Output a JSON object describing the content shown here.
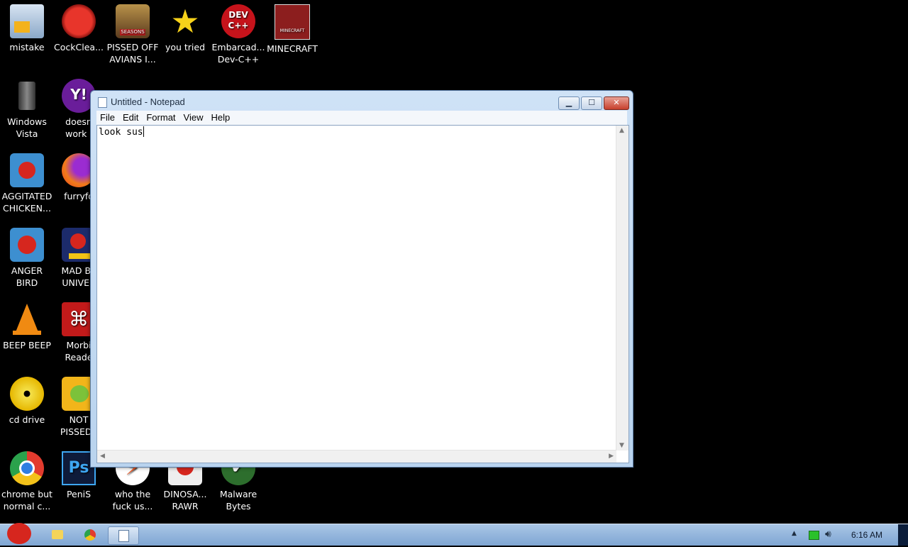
{
  "desktop": {
    "icons": [
      {
        "label": "mistake"
      },
      {
        "label": "CockClea..."
      },
      {
        "label": "PISSED OFF\nAVIANS I..."
      },
      {
        "label": "you tried"
      },
      {
        "label": "Embarcad...\nDev-C++"
      },
      {
        "label": "MINECRAFT"
      },
      {
        "label": "Windows\nVista"
      },
      {
        "label": "doesn\nwork l"
      },
      {
        "label": "AGGITATED\nCHICKEN..."
      },
      {
        "label": "furryfo"
      },
      {
        "label": "ANGER\nBIRD"
      },
      {
        "label": "MAD BII\nUNIVER"
      },
      {
        "label": "BEEP BEEP"
      },
      {
        "label": "Morbi\nReade"
      },
      {
        "label": "cd drive"
      },
      {
        "label": "NOT\nPISSED I"
      },
      {
        "label": "chrome but\nnormal c..."
      },
      {
        "label": "PeniS"
      },
      {
        "label": "who the\nfuck us..."
      },
      {
        "label": "DINOSA...\nRAWR"
      },
      {
        "label": "Malware\nBytes"
      }
    ],
    "icon_glyphs": {
      "dev": "DEV\nC++",
      "ps": "Ps",
      "yahoo": "Y!",
      "mc": "MINECRAFT",
      "seasons": "SEASONS"
    }
  },
  "notepad": {
    "title": "Untitled - Notepad",
    "buttons": {
      "minimize": "▁",
      "maximize": "☐",
      "close": "✕"
    },
    "menu": [
      "File",
      "Edit",
      "Format",
      "View",
      "Help"
    ],
    "content": "look sus"
  },
  "taskbar": {
    "clock": "6:16 AM"
  },
  "colors": {
    "taskbar": "#8fb2dc",
    "window_frame": "#c6dbf2",
    "close": "#c7402c"
  }
}
